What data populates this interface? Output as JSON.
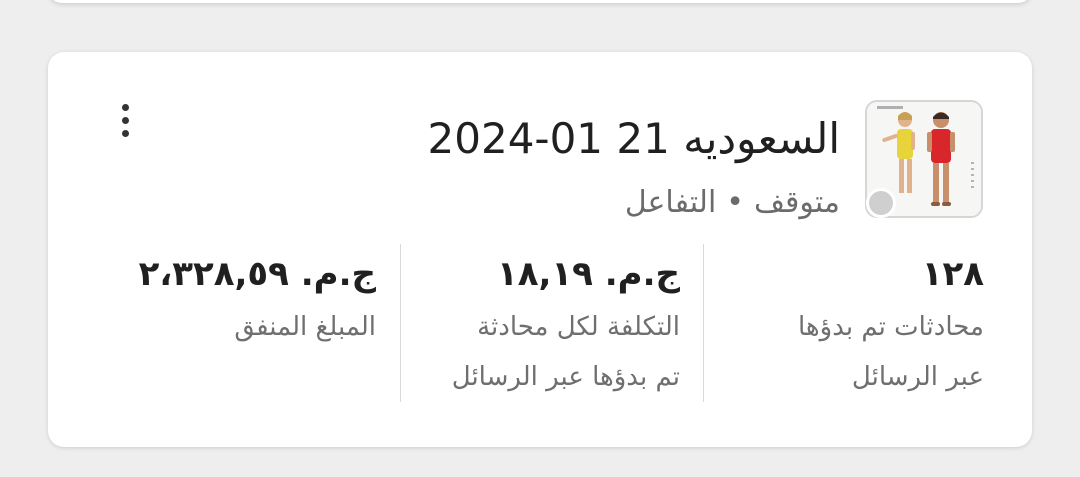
{
  "card": {
    "title": "السعوديه 21 01-2024",
    "status": "متوقف",
    "separator": "•",
    "objective": "التفاعل",
    "metrics": [
      {
        "value": "١٢٨",
        "label_line1": "محادثات تم بدؤها",
        "label_line2": "عبر الرسائل"
      },
      {
        "value": "ج.م. ١٨,١٩",
        "label_line1": "التكلفة لكل محادثة",
        "label_line2": "تم بدؤها عبر الرسائل"
      },
      {
        "value": "ج.م. ٢،٣٢٨,٥٩",
        "label_line1": "المبلغ المنفق",
        "label_line2": ""
      }
    ],
    "status_dot_color": "#cfcfcf"
  },
  "icons": {
    "menu": "more-vertical-icon",
    "thumbnail": "ad-thumbnail-image"
  }
}
